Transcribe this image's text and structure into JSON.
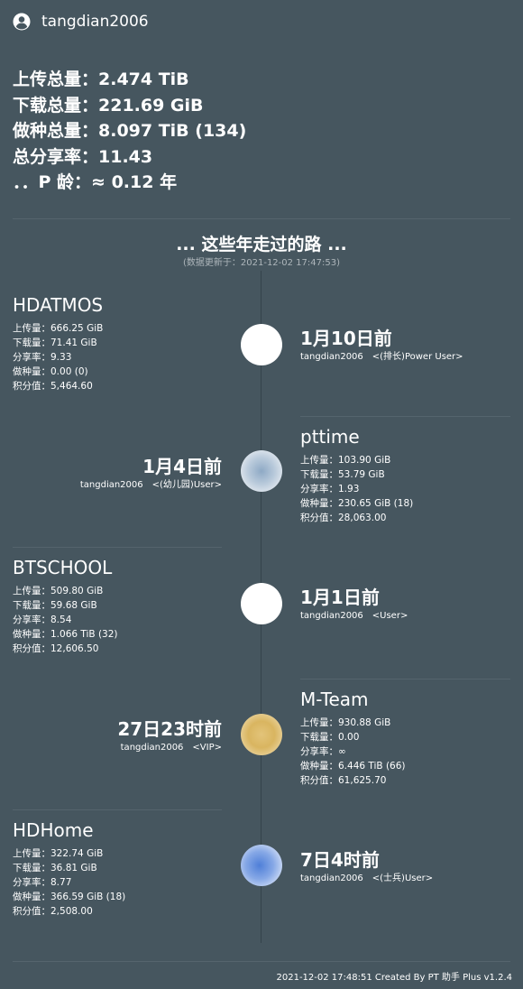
{
  "header": {
    "username": "tangdian2006",
    "icon": "user-circle-icon"
  },
  "summary": [
    "上传总量：2.474 TiB",
    "下载总量：221.69 GiB",
    "做种总量：8.097 TiB (134)",
    "总分享率：11.43",
    "．．P 龄：≈ 0.12 年"
  ],
  "timeline": {
    "title": "... 这些年走过的路 ...",
    "updated": "(数据更新于：2021-12-02 17:47:53)"
  },
  "sites": [
    {
      "name": "HDATMOS",
      "stats": [
        "上传量：666.25 GiB",
        "下载量：71.41 GiB",
        "分享率：9.33",
        "做种量：0.00 (0)",
        "积分值：5,464.60"
      ],
      "time": "1月10日前",
      "rank": "tangdian2006　<(排长)Power User>"
    },
    {
      "name": "pttime",
      "stats": [
        "上传量：103.90 GiB",
        "下载量：53.79 GiB",
        "分享率：1.93",
        "做种量：230.65 GiB (18)",
        "积分值：28,063.00"
      ],
      "time": "1月4日前",
      "rank": "tangdian2006　<(幼儿园)User>"
    },
    {
      "name": "BTSCHOOL",
      "stats": [
        "上传量：509.80 GiB",
        "下载量：59.68 GiB",
        "分享率：8.54",
        "做种量：1.066 TiB (32)",
        "积分值：12,606.50"
      ],
      "time": "1月1日前",
      "rank": "tangdian2006　<User>"
    },
    {
      "name": "M-Team",
      "stats": [
        "上传量：930.88 GiB",
        "下载量：0.00",
        "分享率：∞",
        "做种量：6.446 TiB (66)",
        "积分值：61,625.70"
      ],
      "time": "27日23时前",
      "rank": "tangdian2006　<VIP>"
    },
    {
      "name": "HDHome",
      "stats": [
        "上传量：322.74 GiB",
        "下载量：36.81 GiB",
        "分享率：8.77",
        "做种量：366.59 GiB (18)",
        "积分值：2,508.00"
      ],
      "time": "7日4时前",
      "rank": "tangdian2006　<(士兵)User>"
    }
  ],
  "footer": "2021-12-02 17:48:51 Created By PT 助手 Plus v1.2.4"
}
